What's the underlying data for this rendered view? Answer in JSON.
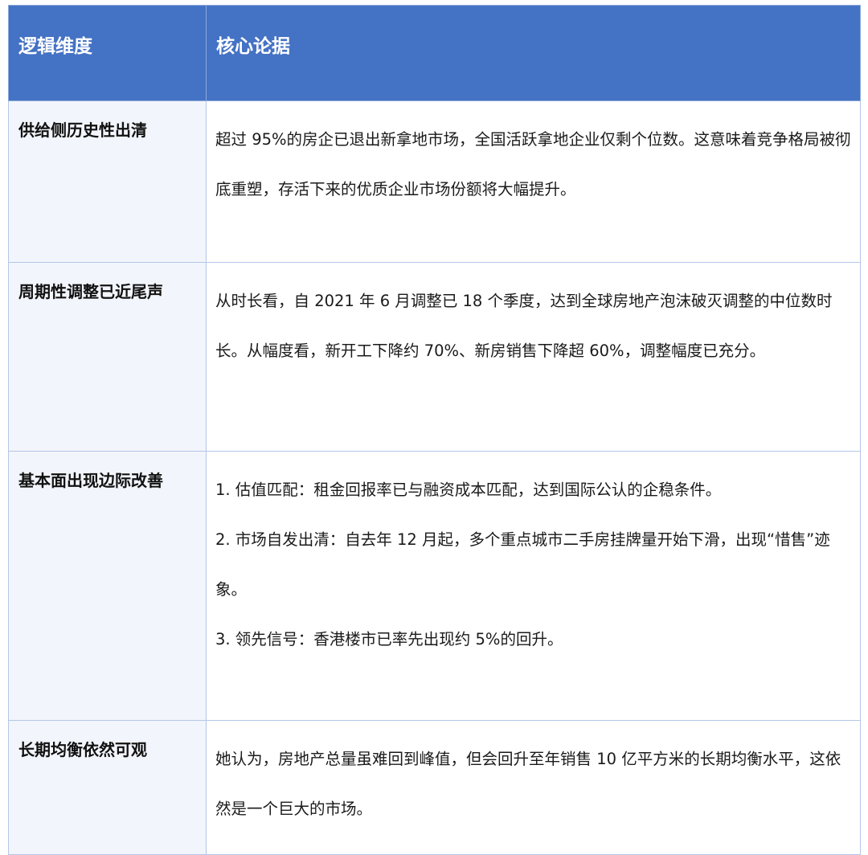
{
  "table": {
    "headers": [
      "逻辑维度",
      "核心论据"
    ],
    "rows": [
      {
        "dimension": "供给侧历史性出清",
        "argument": [
          "超过 95%的房企已退出新拿地市场，全国活跃拿地企业仅剩个位数。这意味着竞争格局被彻底重塑，存活下来的优质企业市场份额将大幅提升。"
        ]
      },
      {
        "dimension": "周期性调整已近尾声",
        "argument": [
          "从时长看，自 2021 年 6 月调整已 18 个季度，达到全球房地产泡沫破灭调整的中位数时长。从幅度看，新开工下降约 70%、新房销售下降超 60%，调整幅度已充分。"
        ]
      },
      {
        "dimension": "基本面出现边际改善",
        "argument": [
          "1. 估值匹配：租金回报率已与融资成本匹配，达到国际公认的企稳条件。",
          "2. 市场自发出清：自去年 12 月起，多个重点城市二手房挂牌量开始下滑，出现“惜售”迹象。",
          "3. 领先信号：香港楼市已率先出现约 5%的回升。"
        ]
      },
      {
        "dimension": "长期均衡依然可观",
        "argument": [
          "她认为，房地产总量虽难回到峰值，但会回升至年销售 10 亿平方米的长期均衡水平，这依然是一个巨大的市场。"
        ]
      }
    ]
  }
}
